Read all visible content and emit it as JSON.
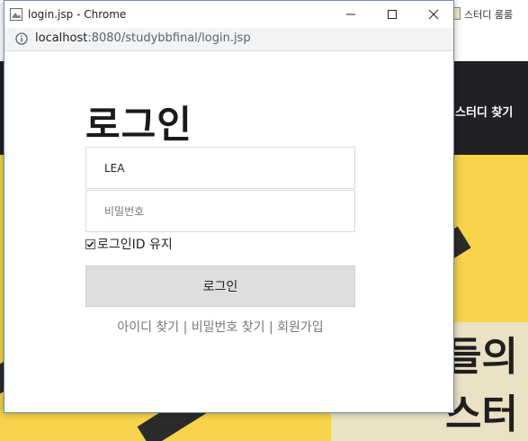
{
  "background_page": {
    "tab_title": "스터디 룸룸",
    "nav_text": "스터디 찾기",
    "hero_lines": [
      "들의",
      "스터"
    ]
  },
  "popup": {
    "window_title": "login.jsp - Chrome",
    "address": {
      "host": "localhost",
      "path": ":8080/studybbfinal/login.jsp"
    },
    "heading": "로그인",
    "id_field": {
      "value": "LEA",
      "placeholder": ""
    },
    "password_field": {
      "value": "",
      "placeholder": "비밀번호"
    },
    "remember_label": "로그인ID 유지",
    "remember_checked": true,
    "login_button": "로그인",
    "links": {
      "find_id": "아이디 찾기",
      "separator": " | ",
      "find_password": "비밀번호 찾기",
      "signup": "회원가입"
    }
  },
  "colors": {
    "nav_dark": "#202124",
    "hero_yellow": "#f7d34a",
    "button_gray": "#dedede",
    "link_gray": "#777777"
  }
}
